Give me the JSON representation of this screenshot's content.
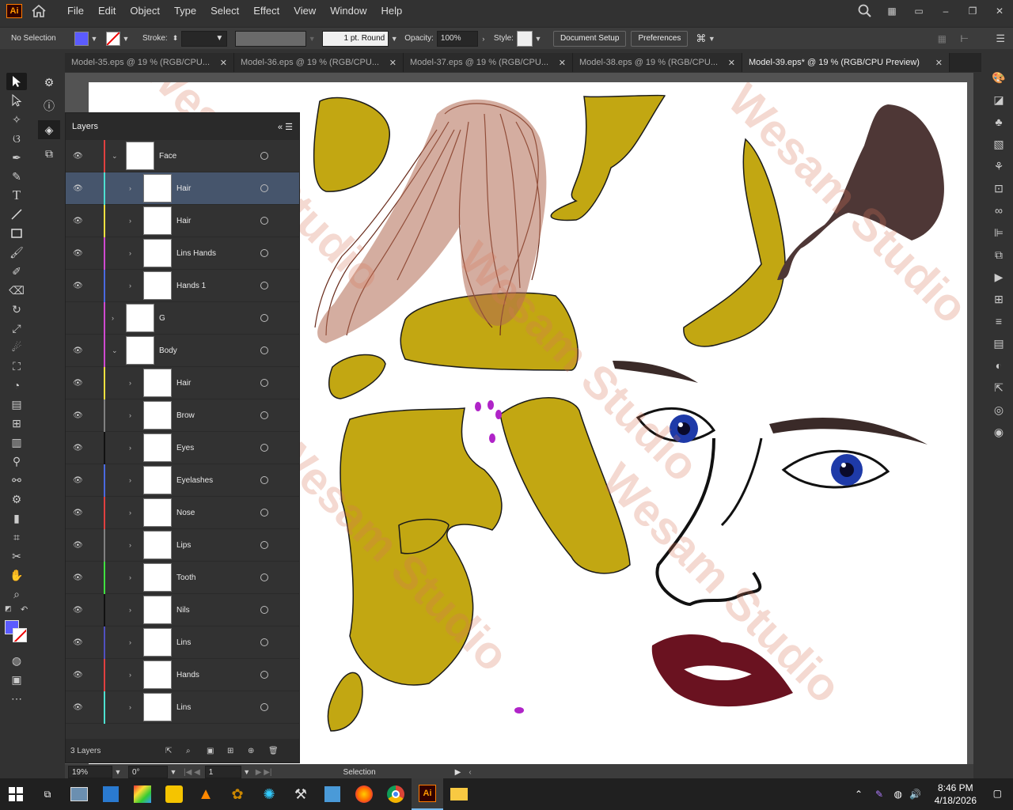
{
  "menubar": {
    "logo": "Ai",
    "items": [
      "File",
      "Edit",
      "Object",
      "Type",
      "Select",
      "Effect",
      "View",
      "Window",
      "Help"
    ]
  },
  "control": {
    "selection": "No Selection",
    "stroke_label": "Stroke:",
    "profile": "1 pt. Round",
    "opacity_label": "Opacity:",
    "opacity": "100%",
    "style_label": "Style:",
    "doc_setup": "Document Setup",
    "preferences": "Preferences",
    "fill_color": "#5b5bff"
  },
  "tabs": [
    {
      "label": "Model-35.eps @ 19 % (RGB/CPU..."
    },
    {
      "label": "Model-36.eps @ 19 % (RGB/CPU..."
    },
    {
      "label": "Model-37.eps @ 19 % (RGB/CPU..."
    },
    {
      "label": "Model-38.eps @ 19 % (RGB/CPU..."
    },
    {
      "label": "Model-39.eps* @ 19 % (RGB/CPU Preview)"
    }
  ],
  "layers": {
    "title": "Layers",
    "footer": "3 Layers",
    "rows": [
      {
        "name": "Face",
        "visible": true,
        "color": "#e04040",
        "level": 0,
        "expanded": true
      },
      {
        "name": "Hair",
        "visible": true,
        "color": "#4de0d0",
        "level": 1,
        "selected": true
      },
      {
        "name": "Hair",
        "visible": true,
        "color": "#f0e040",
        "level": 1
      },
      {
        "name": "Lins Hands",
        "visible": true,
        "color": "#d04ad0",
        "level": 1
      },
      {
        "name": "Hands 1",
        "visible": true,
        "color": "#4a6ae0",
        "level": 1
      },
      {
        "name": "G",
        "visible": false,
        "color": "#d04ad0",
        "level": 0
      },
      {
        "name": "Body",
        "visible": true,
        "color": "#d04ad0",
        "level": 0,
        "expanded": true
      },
      {
        "name": "Hair",
        "visible": true,
        "color": "#f0e040",
        "level": 1
      },
      {
        "name": "Brow",
        "visible": true,
        "color": "#808080",
        "level": 1
      },
      {
        "name": "Eyes",
        "visible": true,
        "color": "#111111",
        "level": 1
      },
      {
        "name": "Eyelashes",
        "visible": true,
        "color": "#4a6ae0",
        "level": 1
      },
      {
        "name": "Nose",
        "visible": true,
        "color": "#e04040",
        "level": 1
      },
      {
        "name": "Lips",
        "visible": true,
        "color": "#808080",
        "level": 1
      },
      {
        "name": "Tooth",
        "visible": true,
        "color": "#40e040",
        "level": 1
      },
      {
        "name": "Nils",
        "visible": true,
        "color": "#111111",
        "level": 1
      },
      {
        "name": "Lins",
        "visible": true,
        "color": "#5050c0",
        "level": 1
      },
      {
        "name": "Hands",
        "visible": true,
        "color": "#e04040",
        "level": 1
      },
      {
        "name": "Lins",
        "visible": true,
        "color": "#4de0d0",
        "level": 1
      }
    ]
  },
  "status": {
    "zoom": "19%",
    "rotation": "0°",
    "artboard": "1",
    "tool": "Selection"
  },
  "taskbar": {
    "time": "8:46 PM",
    "date": "4/18/2026"
  },
  "watermark": "Wesam Studio"
}
